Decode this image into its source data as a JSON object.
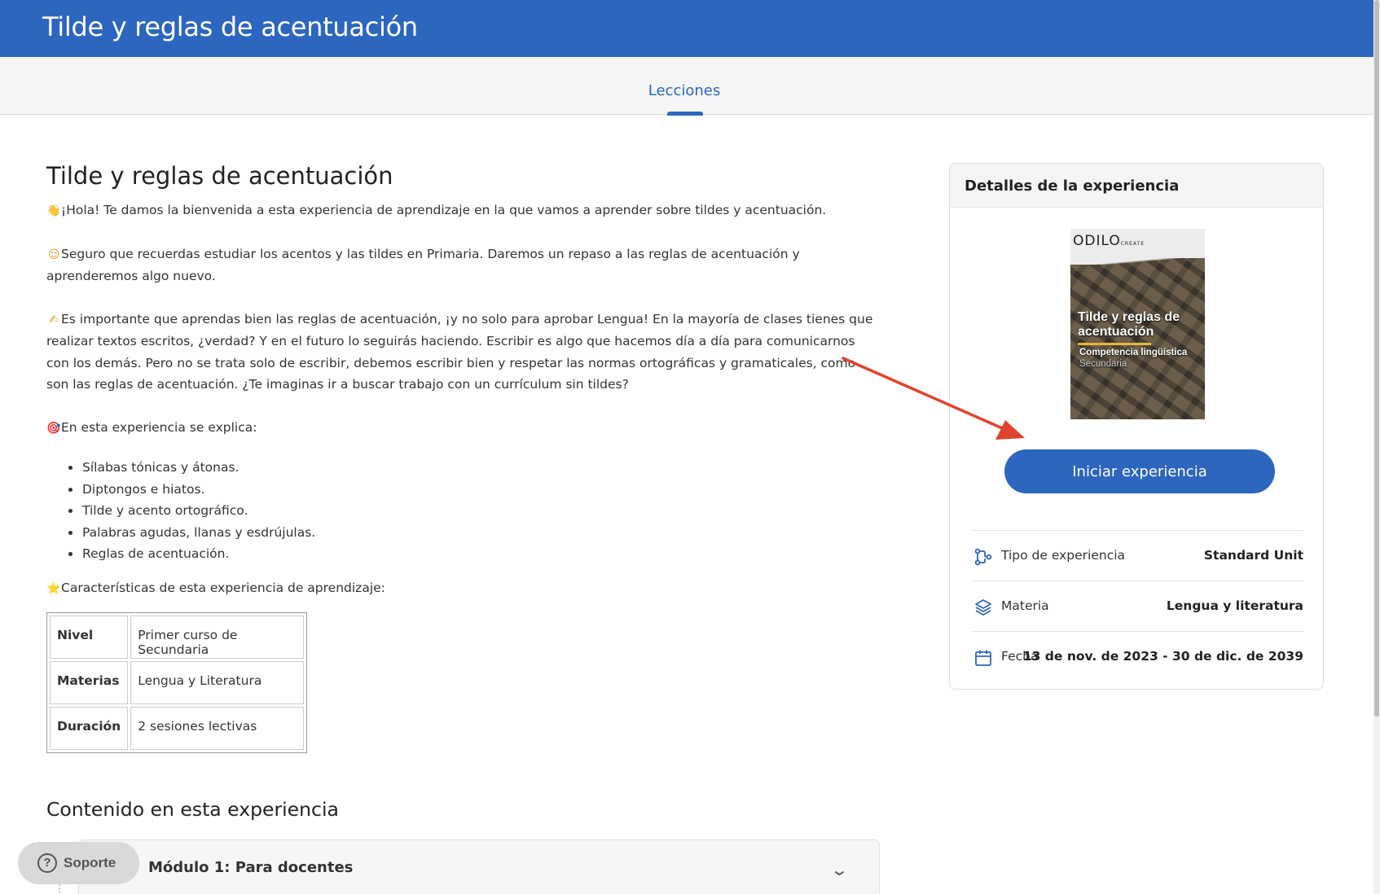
{
  "header": {
    "title": "Tilde y reglas de acentuación"
  },
  "tabs": [
    {
      "label": "Lecciones",
      "active": true
    }
  ],
  "main": {
    "title": "Tilde y reglas de acentuación",
    "paragraphs": [
      {
        "emoji": "👋",
        "text": "¡Hola! Te damos la bienvenida a esta experiencia de aprendizaje en la que vamos a aprender sobre tildes y acentuación."
      },
      {
        "emoji": "😌",
        "text": "Seguro que recuerdas estudiar los acentos y las tildes en Primaria. Daremos un repaso a las reglas de acentuación y aprenderemos algo nuevo."
      },
      {
        "emoji": "✍",
        "text": "Es importante que aprendas bien las reglas de acentuación, ¡y no solo para aprobar Lengua! En la mayoría de clases tienes que realizar textos escritos, ¿verdad? Y en el futuro lo seguirás haciendo. Escribir es algo que hacemos día a día para comunicarnos con los demás. Pero no se trata solo de escribir, debemos escribir bien y respetar las normas ortográficas y gramaticales, como son las reglas de acentuación. ¿Te imaginas ir a buscar trabajo con un currículum sin tildes?"
      },
      {
        "emoji": "🎯",
        "text": "En esta experiencia se explica:"
      }
    ],
    "topics": [
      "Sílabas tónicas y átonas.",
      "Diptongos e hiatos.",
      "Tilde y acento ortográfico.",
      "Palabras agudas, llanas y esdrújulas.",
      "Reglas de acentuación."
    ],
    "features_intro": {
      "emoji": "⭐",
      "text": "Características de esta experiencia de aprendizaje:"
    },
    "info_table": [
      {
        "key": "Nivel",
        "value": "Primer curso de Secundaria"
      },
      {
        "key": "Materias",
        "value": "Lengua y Literatura"
      },
      {
        "key": "Duración",
        "value": "2 sesiones lectivas"
      }
    ],
    "content_title": "Contenido en esta experiencia",
    "modules": [
      {
        "label": "Módulo 1: Para docentes"
      }
    ]
  },
  "support": {
    "label": "Soporte"
  },
  "details": {
    "title": "Detalles de la experiencia",
    "cover": {
      "logo": "ODILO",
      "logo_suffix": "CREATE",
      "title": "Tilde y reglas de acentuación",
      "subtitle": "Competencia lingüística",
      "level": "Secundaria"
    },
    "start_label": "Iniciar experiencia",
    "rows": [
      {
        "icon": "flow-icon",
        "key": "Tipo de experiencia",
        "value": "Standard Unit"
      },
      {
        "icon": "layers-icon",
        "key": "Materia",
        "value": "Lengua y literatura"
      },
      {
        "icon": "calendar-icon",
        "key": "Fecha",
        "value": "13 de nov. de 2023 - 30 de dic. de 2039"
      }
    ]
  },
  "colors": {
    "brand": "#2d66bf",
    "arrow": "#e0442d"
  }
}
